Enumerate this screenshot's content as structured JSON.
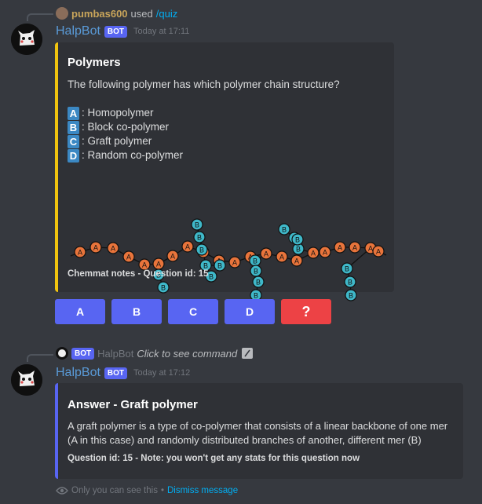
{
  "quiz_message": {
    "reply": {
      "user": "pumbas600",
      "used": "used",
      "command": "/quiz"
    },
    "author": "HalpBot",
    "bot_tag": "BOT",
    "timestamp": "Today at 17:11",
    "embed": {
      "accent_color": "#f1c40f",
      "title": "Polymers",
      "question": "The following polymer has which polymer chain structure?",
      "options": [
        {
          "letter": "A",
          "text": ": Homopolymer"
        },
        {
          "letter": "B",
          "text": ": Block co-polymer"
        },
        {
          "letter": "C",
          "text": ": Graft polymer"
        },
        {
          "letter": "D",
          "text": ": Random co-polymer"
        }
      ],
      "diagram": {
        "mer_a_label": "A",
        "mer_b_label": "B",
        "mer_a_color": "#e8743b",
        "mer_b_color": "#3fb8c9"
      },
      "footer": "Chemmat notes - Question id: 15"
    },
    "buttons": [
      {
        "label": "A",
        "style": "primary"
      },
      {
        "label": "B",
        "style": "primary"
      },
      {
        "label": "C",
        "style": "primary"
      },
      {
        "label": "D",
        "style": "primary"
      },
      {
        "label": "?",
        "style": "danger"
      }
    ]
  },
  "answer_message": {
    "command_line": {
      "bot_tag": "BOT",
      "bot_name": "HalpBot",
      "text": "Click to see command"
    },
    "author": "HalpBot",
    "bot_tag": "BOT",
    "timestamp": "Today at 17:12",
    "embed": {
      "accent_color": "#5865f2",
      "title": "Answer - Graft polymer",
      "description": "A graft polymer is a type of co-polymer that consists of a linear backbone of one mer (A in this case) and randomly distributed branches of another, different mer (B)",
      "footer": "Question id: 15 - Note: you won't get any stats for this question now"
    },
    "ephemeral": {
      "text": "Only you can see this",
      "separator": "•",
      "dismiss": "Dismiss message"
    }
  }
}
